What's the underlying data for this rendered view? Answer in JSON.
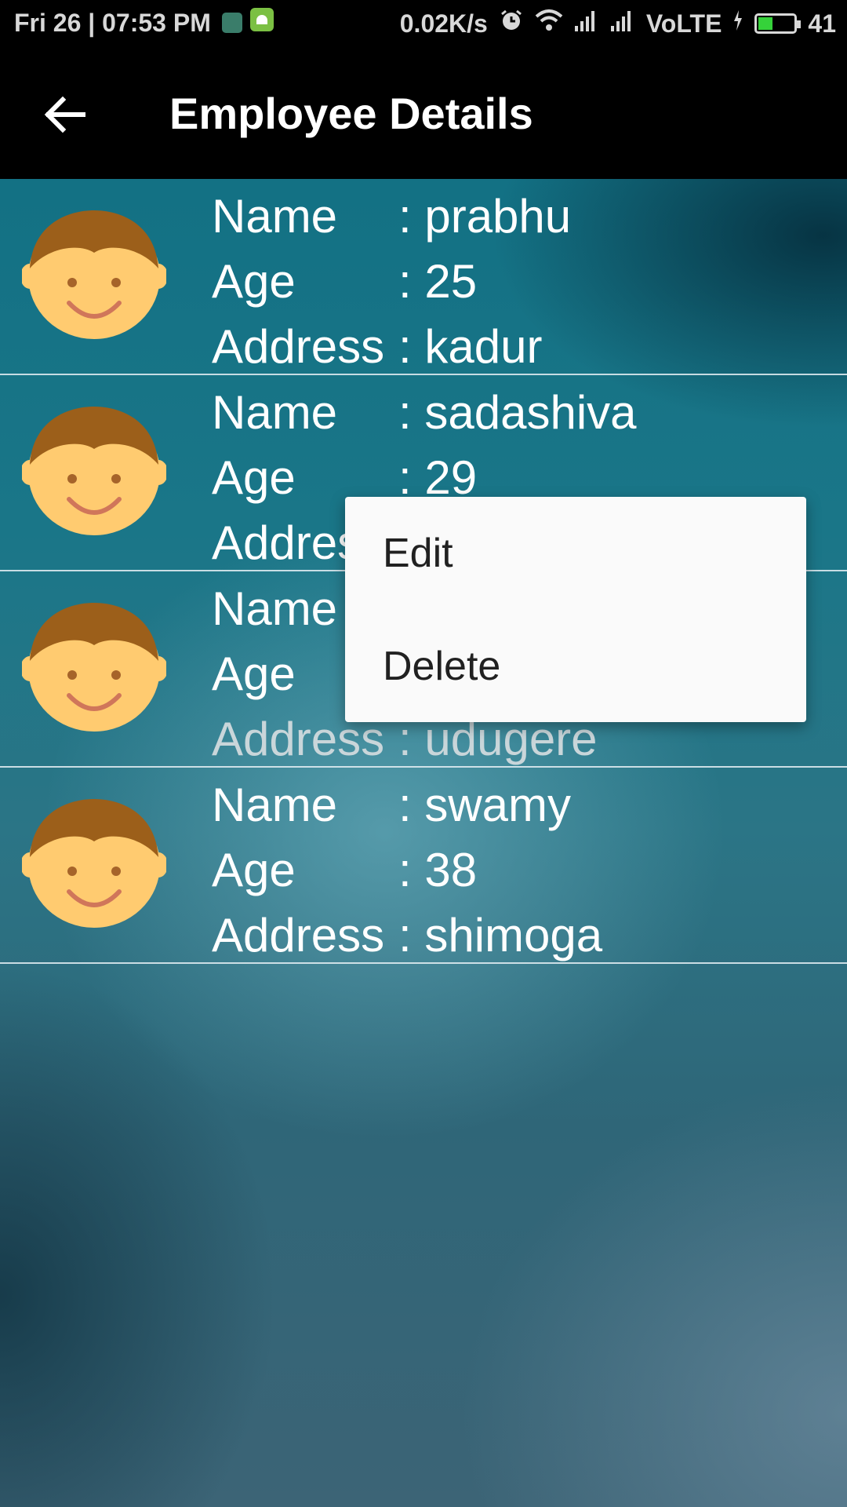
{
  "status_bar": {
    "datetime": "Fri 26 | 07:53 PM",
    "net_speed": "0.02K/s",
    "network_label": "VoLTE",
    "battery_level": "41",
    "battery_fraction": 0.41,
    "icons": [
      "notification-app-icon",
      "android-icon",
      "alarm-icon",
      "wifi-icon",
      "signal-icon",
      "signal-icon",
      "charging-icon",
      "battery-icon"
    ]
  },
  "app_bar": {
    "title": "Employee Details",
    "back_icon": "arrow-back-icon"
  },
  "labels": {
    "name": "Name",
    "age": "Age",
    "address": "Address"
  },
  "employees": [
    {
      "name": ": prabhu",
      "age": ": 25",
      "address": ": kadur"
    },
    {
      "name": ": sadashiva",
      "age": ": 29",
      "address": ""
    },
    {
      "name": "",
      "age": "",
      "address": ": udugere"
    },
    {
      "name": ": swamy",
      "age": ": 38",
      "address": ": shimoga"
    }
  ],
  "context_menu": {
    "items": [
      "Edit",
      "Delete"
    ]
  },
  "colors": {
    "app_bar": "#000000",
    "avatar_face": "#FFCB70",
    "avatar_hair": "#9C5F1A",
    "battery_fill": "#35D23A"
  }
}
